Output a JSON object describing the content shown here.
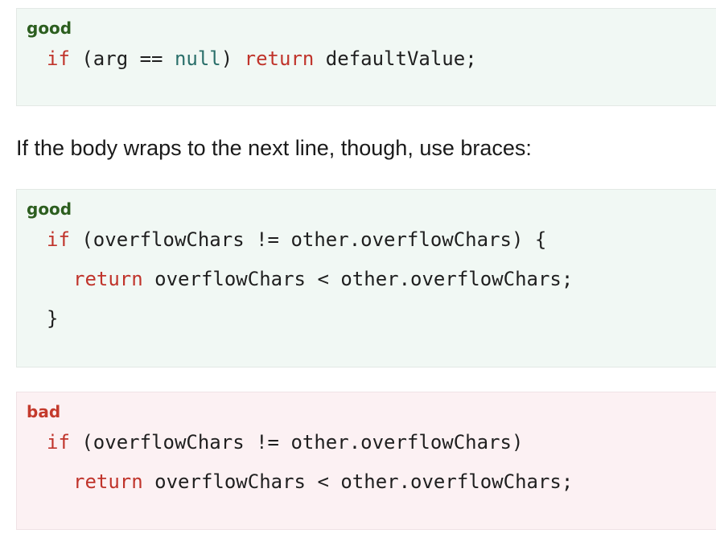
{
  "good_block_1": {
    "tag": "good",
    "line1": {
      "kw_if": "if",
      "open": " (arg == ",
      "null_kw": "null",
      "close": ") ",
      "kw_return": "return",
      "rest": " defaultValue;"
    }
  },
  "prose": {
    "text": "If the body wraps to the next line, though, use braces:"
  },
  "good_block_2": {
    "tag": "good",
    "line1": {
      "kw_if": "if",
      "rest": " (overflowChars != other.overflowChars) {"
    },
    "line2": {
      "kw_return": "return",
      "rest": " overflowChars < other.overflowChars;"
    },
    "line3": {
      "rest": "}"
    }
  },
  "bad_block": {
    "tag": "bad",
    "line1": {
      "kw_if": "if",
      "rest": " (overflowChars != other.overflowChars)"
    },
    "line2": {
      "kw_return": "return",
      "rest": " overflowChars < other.overflowChars;"
    }
  },
  "colors": {
    "good_bg": "#f1f8f4",
    "bad_bg": "#fcf1f3",
    "good_tag": "#2c5e1f",
    "bad_tag": "#c43a2c",
    "keyword": "#c0342b",
    "literal": "#2a6f6a"
  }
}
